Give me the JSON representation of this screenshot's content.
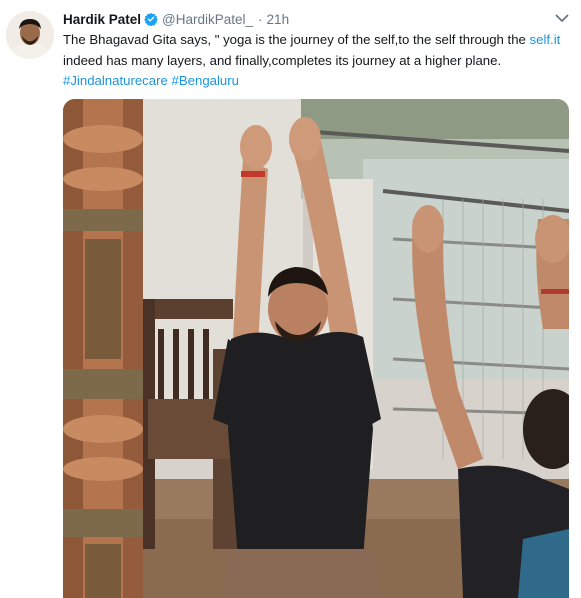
{
  "tweet": {
    "author": {
      "name": "Hardik Patel",
      "handle": "@HardikPatel_",
      "verified": true
    },
    "separator": "·",
    "time": "21h",
    "text": {
      "part1": "The Bhagavad Gita says, \" yoga is the journey of the self,to the self through the ",
      "link1": "self.it",
      "part2": " indeed has many layers, and finally,completes its journey at a higher plane. ",
      "hashtag1": "#Jindalnaturecare",
      "space": " ",
      "hashtag2": "#Bengaluru"
    },
    "icons": {
      "verified": "verified-badge-icon",
      "menu": "chevron-down-icon"
    },
    "colors": {
      "link": "#1b95e0",
      "verified": "#1da1f2",
      "muted": "#657786"
    }
  }
}
